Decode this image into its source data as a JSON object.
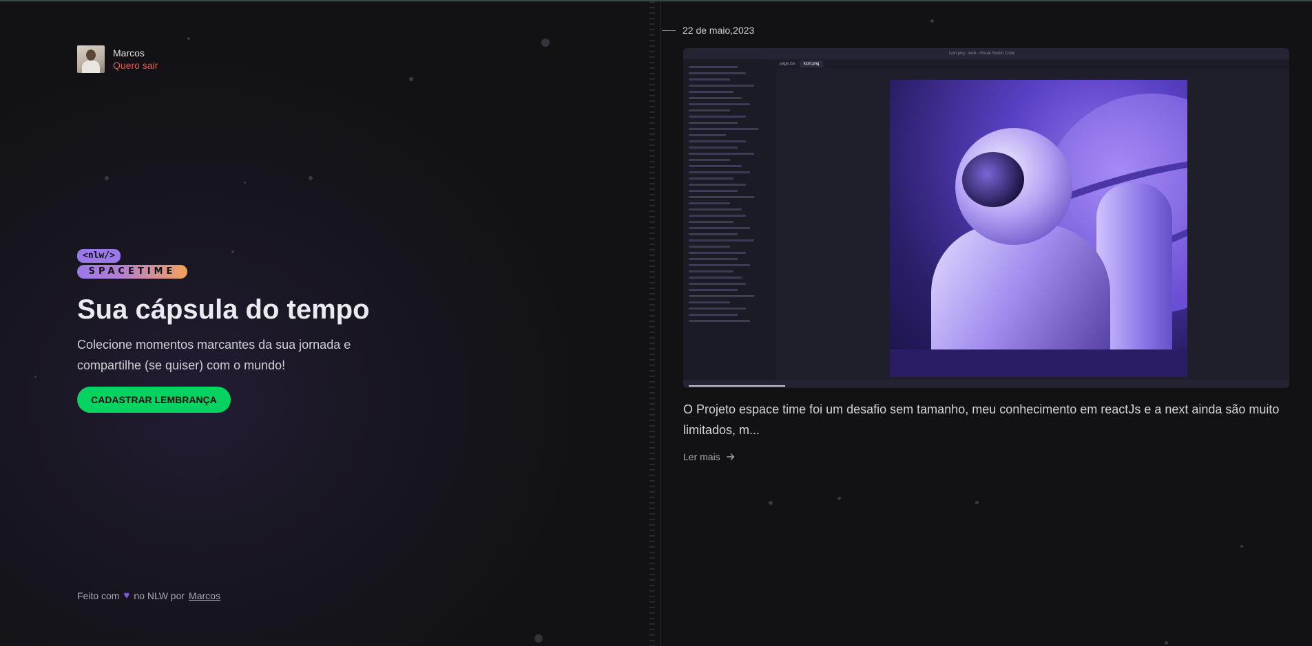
{
  "user": {
    "name": "Marcos",
    "logout_label": "Quero sair"
  },
  "logo": {
    "tag": "<nlw/>",
    "word": "SPACETIME"
  },
  "hero": {
    "title": "Sua cápsula do tempo",
    "subtitle": "Colecione momentos marcantes da sua jornada e compartilhe (se quiser) com o mundo!",
    "cta_label": "CADASTRAR LEMBRANÇA"
  },
  "footer": {
    "prefix": "Feito com",
    "middle": "no NLW por",
    "author": "Marcos"
  },
  "memory": {
    "date": "22 de maio,2023",
    "description": "O Projeto espace time foi um desafio sem tamanho, meu conhecimento em reactJs e a next ainda são muito limitados, m...",
    "read_more_label": "Ler mais",
    "image_window_title": "icon.png - web - Visual Studio Code",
    "image_tabs": [
      "page.tsx",
      "icon.png"
    ]
  },
  "colors": {
    "accent_green": "#04d361",
    "accent_purple": "#8257e5",
    "logout_red": "#ef5350",
    "background": "#121215"
  },
  "icons": {
    "heart": "heart-icon",
    "arrow": "arrow-right-icon"
  }
}
